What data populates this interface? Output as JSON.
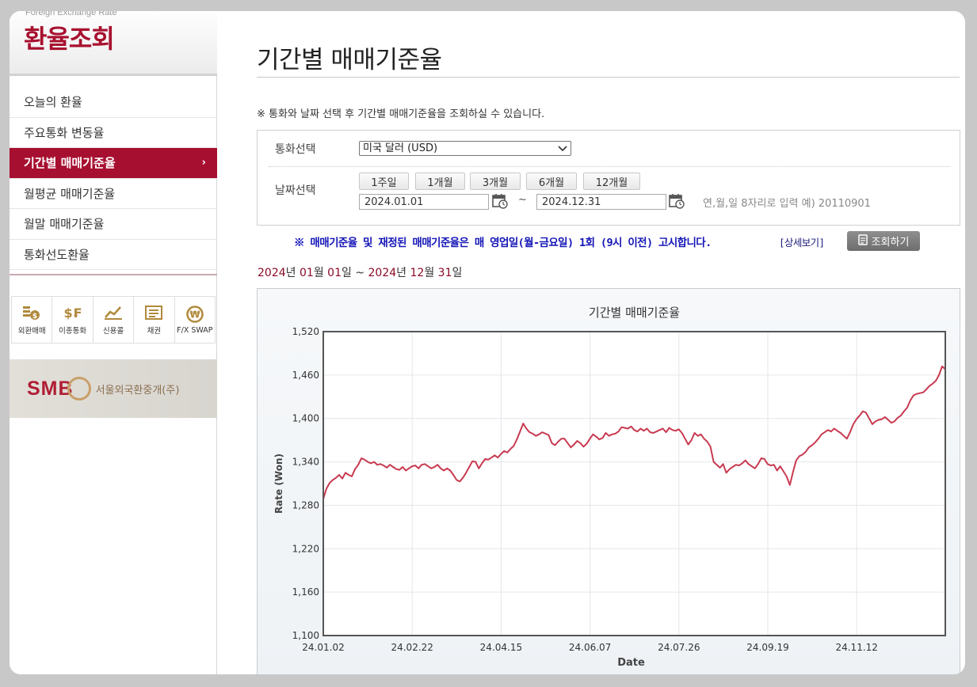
{
  "sidebar": {
    "header_en": "Foreign Exchange Rate",
    "header_ko": "환율조회",
    "items": [
      {
        "label": "오늘의 환율"
      },
      {
        "label": "주요통화 변동율"
      },
      {
        "label": "기간별 매매기준율",
        "active": true
      },
      {
        "label": "월평균 매매기준율"
      },
      {
        "label": "월말 매매기준율"
      },
      {
        "label": "통화선도환율"
      }
    ],
    "quick_links": [
      {
        "label": "외환매매",
        "icon": "fx-trade-icon"
      },
      {
        "label": "이종통화",
        "icon": "cross-currency-icon"
      },
      {
        "label": "신용콜",
        "icon": "credit-call-icon"
      },
      {
        "label": "채권",
        "icon": "bond-icon"
      },
      {
        "label": "F/X SWAP",
        "icon": "won-swap-icon"
      }
    ],
    "banner": {
      "logo": "SMB",
      "text": "서울외국환중개(주)"
    }
  },
  "main": {
    "title": "기간별 매매기준율",
    "notice": "※ 통화와 날짜 선택 후 기간별 매매기준율을 조회하실 수 있습니다.",
    "currency_label": "통화선택",
    "currency_value": "미국 달러 (USD)",
    "date_label": "날짜선택",
    "periods": [
      "1주일",
      "1개월",
      "3개월",
      "6개월",
      "12개월"
    ],
    "start_date": "2024.01.01",
    "end_date": "2024.12.31",
    "tilde": "~",
    "date_hint": "연,월,일 8자리로 입력 예) 20110901",
    "warning": "※ 매매기준율 및 재정된 매매기준율은 매 영업일(월-금요일) 1회 (9시 이전) 고시합니다.",
    "detail_link": "[상세보기]",
    "search_button": "조회하기",
    "range": {
      "y1": "2024",
      "m1": "01",
      "d1": "01",
      "y2": "2024",
      "m2": "12",
      "d2": "31",
      "year": "년",
      "month": "월",
      "day": "일",
      "sep": "~"
    }
  },
  "colors": {
    "accent": "#a70f30",
    "line": "#c83a50"
  },
  "chart_data": {
    "type": "line",
    "title": "기간별 매매기준율",
    "xlabel": "Date",
    "ylabel": "Rate (Won)",
    "ylim": [
      1100,
      1520
    ],
    "yticks": [
      1100,
      1160,
      1220,
      1280,
      1340,
      1400,
      1460,
      1520
    ],
    "ytick_labels": [
      "1,100",
      "1,160",
      "1,220",
      "1,280",
      "1,340",
      "1,400",
      "1,460",
      "1,520"
    ],
    "xticks": [
      "24.01.02",
      "24.02.22",
      "24.04.15",
      "24.06.07",
      "24.07.26",
      "24.09.19",
      "24.11.12"
    ],
    "grid": true,
    "legend": "none",
    "series": [
      {
        "values": [
          1289,
          1303,
          1311,
          1315,
          1318,
          1322,
          1317,
          1325,
          1322,
          1320,
          1330,
          1336,
          1345,
          1343,
          1340,
          1338,
          1340,
          1336,
          1337,
          1335,
          1332,
          1336,
          1333,
          1330,
          1329,
          1333,
          1328,
          1331,
          1334,
          1335,
          1331,
          1336,
          1337,
          1334,
          1331,
          1333,
          1336,
          1331,
          1328,
          1331,
          1328,
          1322,
          1315,
          1313,
          1318,
          1325,
          1333,
          1341,
          1340,
          1331,
          1338,
          1344,
          1343,
          1346,
          1349,
          1346,
          1351,
          1355,
          1353,
          1358,
          1362,
          1371,
          1382,
          1393,
          1386,
          1381,
          1379,
          1376,
          1378,
          1381,
          1379,
          1377,
          1366,
          1363,
          1368,
          1372,
          1372,
          1366,
          1360,
          1364,
          1369,
          1366,
          1361,
          1365,
          1372,
          1378,
          1375,
          1371,
          1373,
          1380,
          1376,
          1378,
          1379,
          1382,
          1388,
          1387,
          1386,
          1389,
          1384,
          1382,
          1386,
          1383,
          1386,
          1381,
          1380,
          1382,
          1384,
          1386,
          1381,
          1387,
          1384,
          1383,
          1385,
          1380,
          1372,
          1364,
          1370,
          1380,
          1376,
          1378,
          1372,
          1368,
          1361,
          1340,
          1336,
          1332,
          1337,
          1325,
          1330,
          1333,
          1336,
          1335,
          1338,
          1342,
          1337,
          1334,
          1331,
          1337,
          1345,
          1344,
          1337,
          1335,
          1336,
          1328,
          1334,
          1327,
          1320,
          1308,
          1326,
          1342,
          1348,
          1350,
          1354,
          1360,
          1363,
          1367,
          1372,
          1378,
          1381,
          1384,
          1382,
          1386,
          1383,
          1380,
          1376,
          1372,
          1381,
          1392,
          1399,
          1404,
          1410,
          1408,
          1400,
          1392,
          1396,
          1398,
          1399,
          1402,
          1398,
          1394,
          1396,
          1401,
          1404,
          1410,
          1415,
          1425,
          1432,
          1434,
          1435,
          1436,
          1440,
          1445,
          1448,
          1452,
          1460,
          1472,
          1468
        ]
      }
    ]
  }
}
